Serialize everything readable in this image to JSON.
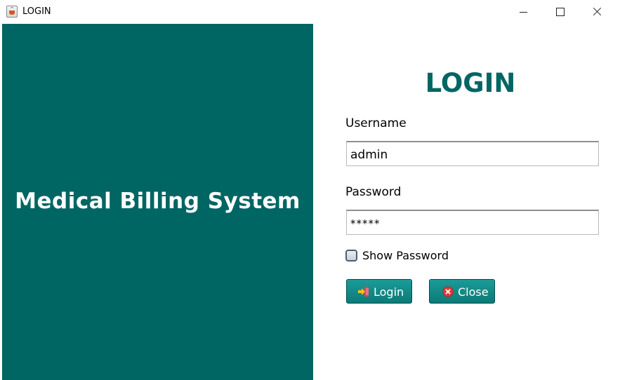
{
  "window": {
    "title": "LOGIN",
    "icon": "java-cup-icon"
  },
  "brand": {
    "title": "Medical Billing System",
    "background_color": "#006663"
  },
  "form": {
    "heading": "LOGIN",
    "heading_color": "#006663",
    "username_label": "Username",
    "username_value": "admin",
    "password_label": "Password",
    "password_value": "*****",
    "show_password_label": "Show Password",
    "show_password_checked": false
  },
  "buttons": {
    "login_label": "Login",
    "login_icon": "login-arrow-icon",
    "close_label": "Close",
    "close_icon": "close-circle-icon",
    "button_color": "#0b7b78"
  }
}
